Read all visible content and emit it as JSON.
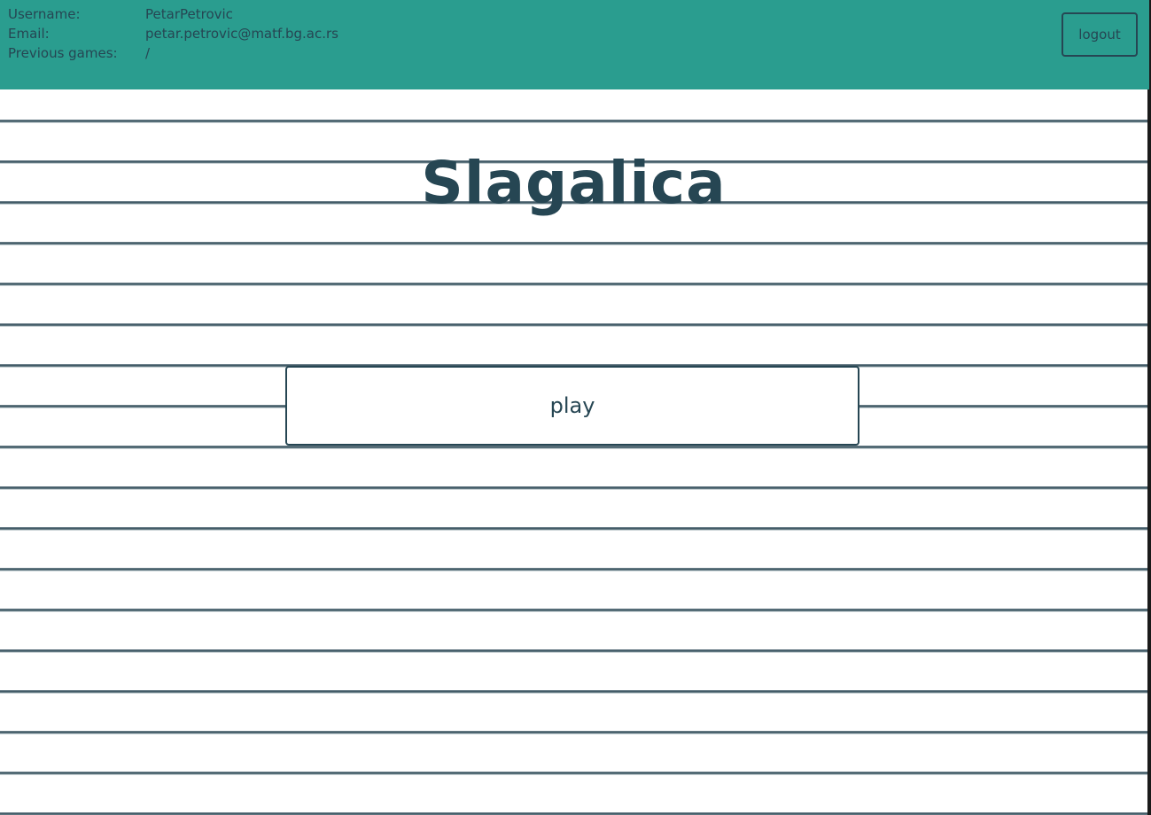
{
  "user_info": {
    "rows": [
      {
        "label": "Username:",
        "value": "PetarPetrovic"
      },
      {
        "label": "Email:",
        "value": "petar.petrovic@matf.bg.ac.rs"
      },
      {
        "label": "Previous games:",
        "value": "/"
      }
    ]
  },
  "header": {
    "logout_label": "logout"
  },
  "main": {
    "title": "Slagalica",
    "play_label": "play"
  },
  "colors": {
    "header_bg": "#2a9d8f",
    "text": "#264653",
    "background": "#ffffff"
  }
}
